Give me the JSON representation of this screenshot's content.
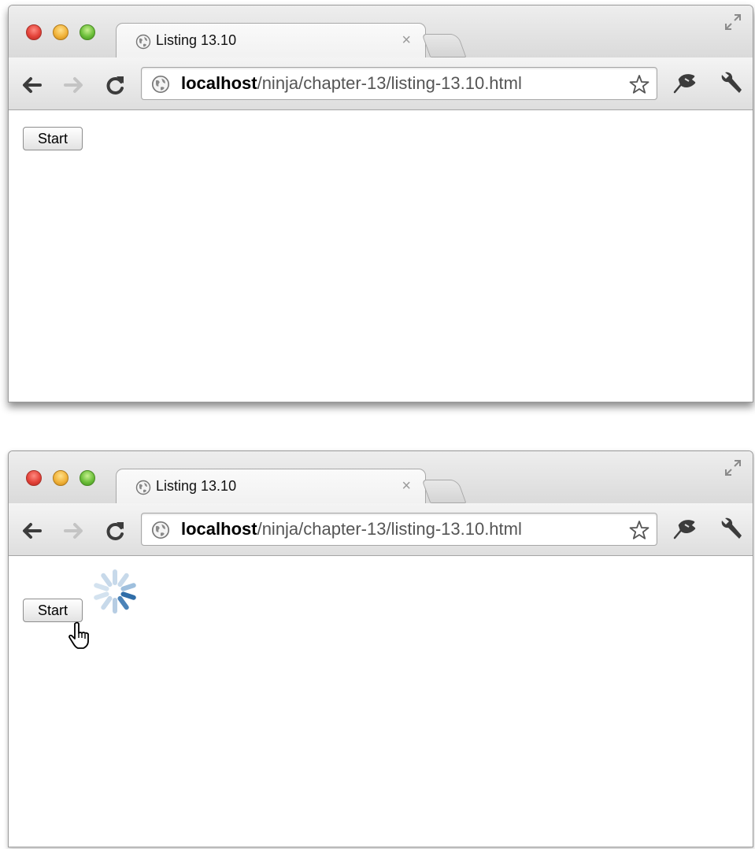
{
  "screens": [
    {
      "tab": {
        "title": "Listing 13.10",
        "close_glyph": "×"
      },
      "address_bar": {
        "host": "localhost",
        "path": "/ninja/chapter-13/listing-13.10.html"
      },
      "page": {
        "start_button_label": "Start",
        "loading": false,
        "cursor": null
      }
    },
    {
      "tab": {
        "title": "Listing 13.10",
        "close_glyph": "×"
      },
      "address_bar": {
        "host": "localhost",
        "path": "/ninja/chapter-13/listing-13.10.html"
      },
      "page": {
        "start_button_label": "Start",
        "loading": true,
        "cursor": "hand-pointer"
      }
    }
  ],
  "icons": {
    "favicon": "globe-icon",
    "back": "back-arrow-icon",
    "forward": "forward-arrow-icon",
    "reload": "reload-icon",
    "bookmark": "star-icon",
    "extension": "extension-icon",
    "menu": "wrench-icon",
    "fullscreen": "fullscreen-icon",
    "spinner": "loading-spinner-icon",
    "cursor": "hand-cursor-icon"
  },
  "colors": {
    "close": "#e4433a",
    "minimize": "#f1b33b",
    "maximize": "#6cbf3a",
    "spinner_dark": "#2f6da8",
    "spinner_light": "#c7d9ea"
  }
}
